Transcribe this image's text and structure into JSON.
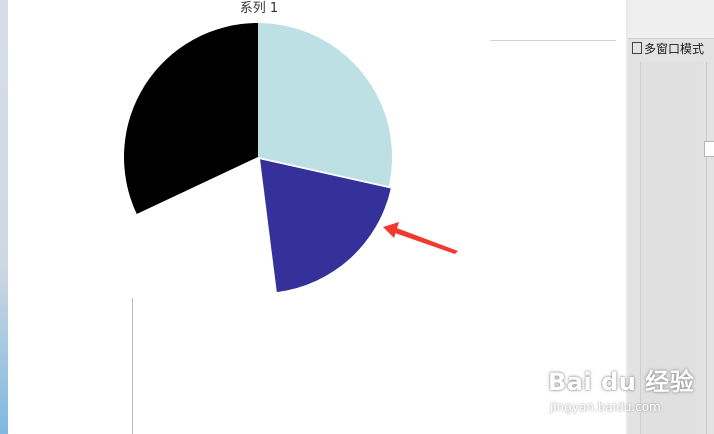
{
  "chart_window": {
    "series_title": "系列 1"
  },
  "toolbar": {
    "multi_window_label": "多窗口模式"
  },
  "watermark": {
    "logo_text": "Bai du 经验",
    "url_text": "jingyan.baidu.com"
  },
  "chart_data": {
    "type": "pie",
    "title": "系列 1",
    "start_angle_deg": 0,
    "slices": [
      {
        "value": 28.5,
        "color": "#bde0e4",
        "exploded": false
      },
      {
        "value": 19.5,
        "color": "#34329a",
        "exploded": true
      },
      {
        "value": 20.0,
        "color": "#ffffff",
        "exploded": false
      },
      {
        "value": 32.0,
        "color": "#000000",
        "exploded": false
      }
    ],
    "annotation": {
      "type": "arrow",
      "color": "#f03a30",
      "points_to_slice": 1
    }
  }
}
